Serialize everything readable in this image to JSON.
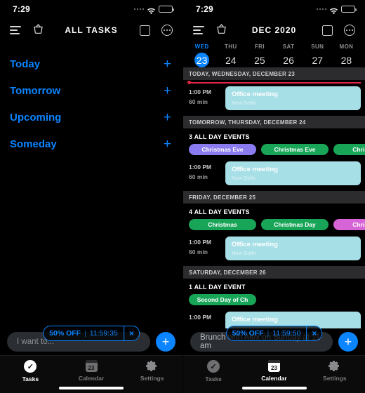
{
  "left": {
    "status": {
      "time": "7:29"
    },
    "nav": {
      "title": "ALL TASKS",
      "menu_icon": "hamburger-icon",
      "basket_icon": "basket-icon",
      "square_icon": "square-icon",
      "more_icon": "more-circle-icon"
    },
    "lists": [
      {
        "label": "Today",
        "add": "+"
      },
      {
        "label": "Tomorrow",
        "add": "+"
      },
      {
        "label": "Upcoming",
        "add": "+"
      },
      {
        "label": "Someday",
        "add": "+"
      }
    ],
    "promo": {
      "discount": "50% OFF",
      "divider": "|",
      "timer": "11:59:35",
      "close": "×"
    },
    "input": {
      "placeholder": "I want to...",
      "value": "",
      "add_button": "+"
    },
    "tabs": [
      {
        "label": "Tasks",
        "icon": "check-circle-icon",
        "active": true
      },
      {
        "label": "Calendar",
        "icon": "calendar-icon",
        "active": false
      },
      {
        "label": "Settings",
        "icon": "gear-icon",
        "active": false
      }
    ]
  },
  "right": {
    "status": {
      "time": "7:29"
    },
    "nav": {
      "title": "DEC 2020",
      "menu_icon": "hamburger-icon",
      "basket_icon": "basket-icon",
      "square_icon": "square-icon",
      "more_icon": "more-circle-icon"
    },
    "days": [
      {
        "dow": "WED",
        "num": "23",
        "selected": true
      },
      {
        "dow": "THU",
        "num": "24",
        "selected": false
      },
      {
        "dow": "FRI",
        "num": "25",
        "selected": false
      },
      {
        "dow": "SAT",
        "num": "26",
        "selected": false
      },
      {
        "dow": "SUN",
        "num": "27",
        "selected": false
      },
      {
        "dow": "MON",
        "num": "28",
        "selected": false
      }
    ],
    "sections": [
      {
        "header": "TODAY, WEDNESDAY, DECEMBER 23",
        "now_line": true,
        "allday_label": "",
        "chips": [],
        "events": [
          {
            "time": "1:00 PM",
            "duration": "60 min",
            "title": "Office meeting",
            "location": "New Delhi",
            "color": "#a7dfe6"
          }
        ]
      },
      {
        "header": "TOMORROW, THURSDAY, DECEMBER 24",
        "now_line": false,
        "allday_label": "3 ALL DAY EVENTS",
        "chips": [
          {
            "label": "Christmas Eve",
            "color": "#8b7bf0"
          },
          {
            "label": "Christmas Eve",
            "color": "#18a558"
          },
          {
            "label": "Christmas",
            "color": "#18a558"
          }
        ],
        "events": [
          {
            "time": "1:00 PM",
            "duration": "60 min",
            "title": "Office meeting",
            "location": "New Delhi",
            "color": "#a7dfe6"
          }
        ]
      },
      {
        "header": "FRIDAY, DECEMBER 25",
        "now_line": false,
        "allday_label": "4 ALL DAY EVENTS",
        "chips": [
          {
            "label": "Christmas",
            "color": "#18a558"
          },
          {
            "label": "Christmas Day",
            "color": "#18a558"
          },
          {
            "label": "Christmas",
            "color": "#d664d6"
          }
        ],
        "events": [
          {
            "time": "1:00 PM",
            "duration": "60 min",
            "title": "Office meeting",
            "location": "New Delhi",
            "color": "#a7dfe6"
          }
        ]
      },
      {
        "header": "SATURDAY, DECEMBER 26",
        "now_line": false,
        "allday_label": "1 ALL DAY EVENT",
        "chips": [
          {
            "label": "Second Day of Ch",
            "color": "#18a558"
          }
        ],
        "events": [
          {
            "time": "1:00 PM",
            "duration": "",
            "title": "Office meeting",
            "location": "",
            "color": "#a7dfe6"
          }
        ]
      }
    ],
    "promo": {
      "discount": "50% OFF",
      "divider": "|",
      "timer": "11:59:50",
      "close": "×"
    },
    "input": {
      "placeholder": "",
      "value": "Brunch with Alex on Sunday at 11 am",
      "add_button": "+"
    },
    "tabs": [
      {
        "label": "Tasks",
        "icon": "check-circle-icon",
        "active": false
      },
      {
        "label": "Calendar",
        "icon": "calendar-icon",
        "active": true
      },
      {
        "label": "Settings",
        "icon": "gear-icon",
        "active": false
      }
    ]
  }
}
